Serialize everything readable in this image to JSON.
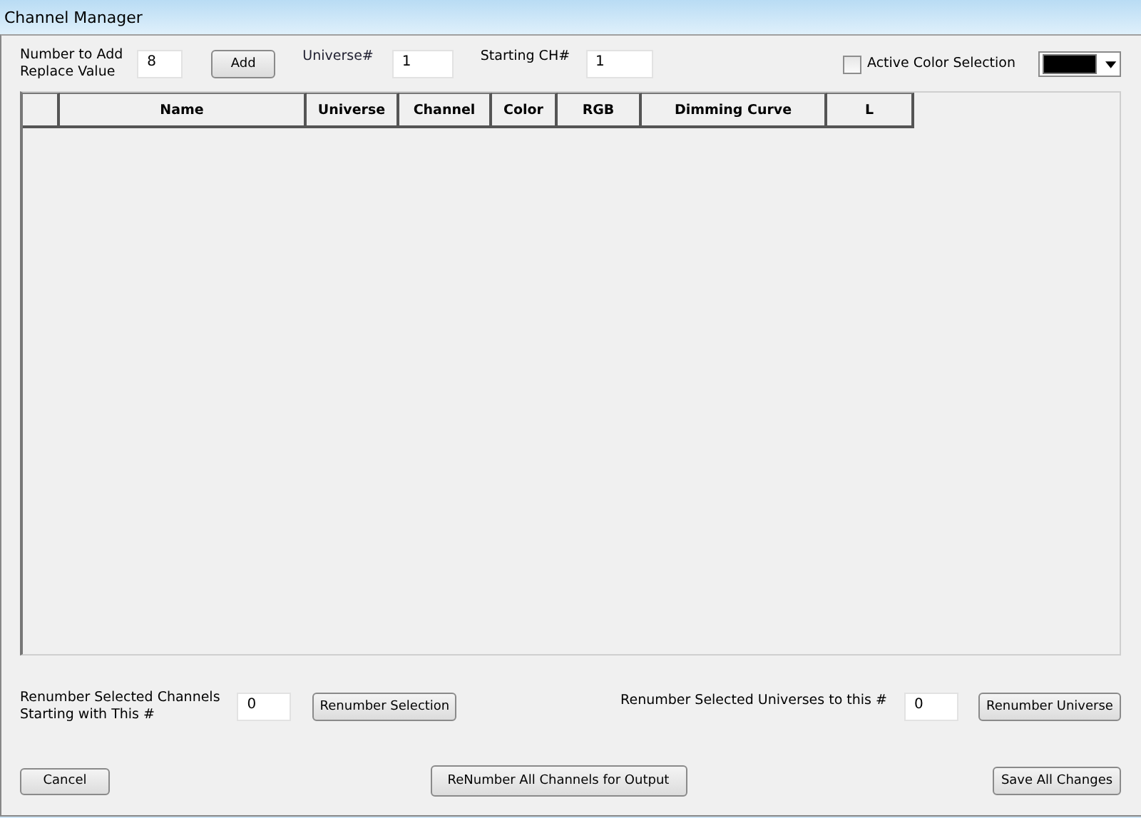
{
  "window": {
    "title": "Channel Manager"
  },
  "top": {
    "number_label": "Number to Add\nReplace Value",
    "number_value": "8",
    "add_button": "Add",
    "universe_label": "Universe#",
    "universe_value": "1",
    "start_label": "Starting CH#",
    "start_value": "1",
    "active_color": {
      "label": "Active Color Selection",
      "checked": false
    }
  },
  "table": {
    "columns": [
      "Name",
      "Universe",
      "Channel",
      "Color",
      "RGB",
      "Dimming Curve",
      "L"
    ]
  },
  "renumber": {
    "channels_label": "Renumber Selected Channels\nStarting with This #",
    "channels_value": "0",
    "channels_button": "Renumber Selection",
    "universes_label": "Renumber Selected Universes to this #",
    "universes_value": "0",
    "universes_button": "Renumber Universe"
  },
  "buttons": {
    "cancel": "Cancel",
    "renumber_all": "ReNumber All Channels for Output",
    "save": "Save All Changes"
  }
}
